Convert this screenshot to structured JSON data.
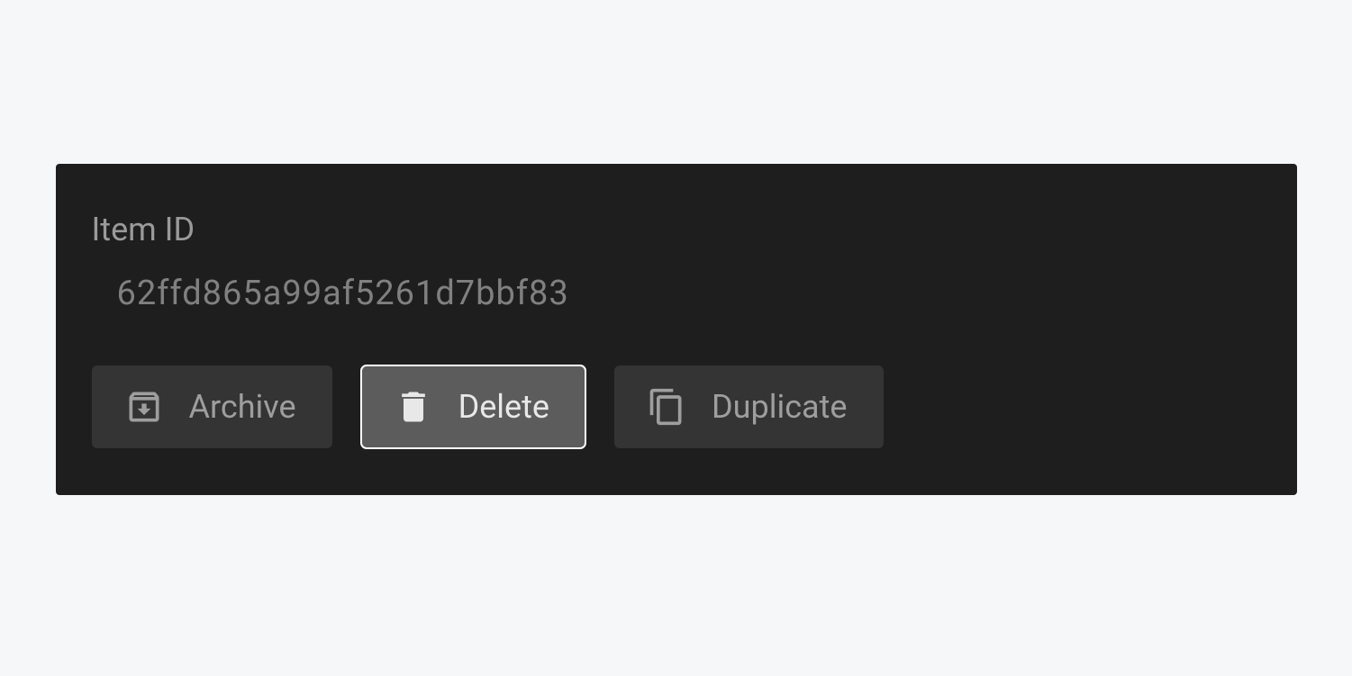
{
  "panel": {
    "field_label": "Item ID",
    "field_value": "62ffd865a99af5261d7bbf83",
    "actions": {
      "archive_label": "Archive",
      "delete_label": "Delete",
      "duplicate_label": "Duplicate"
    }
  }
}
